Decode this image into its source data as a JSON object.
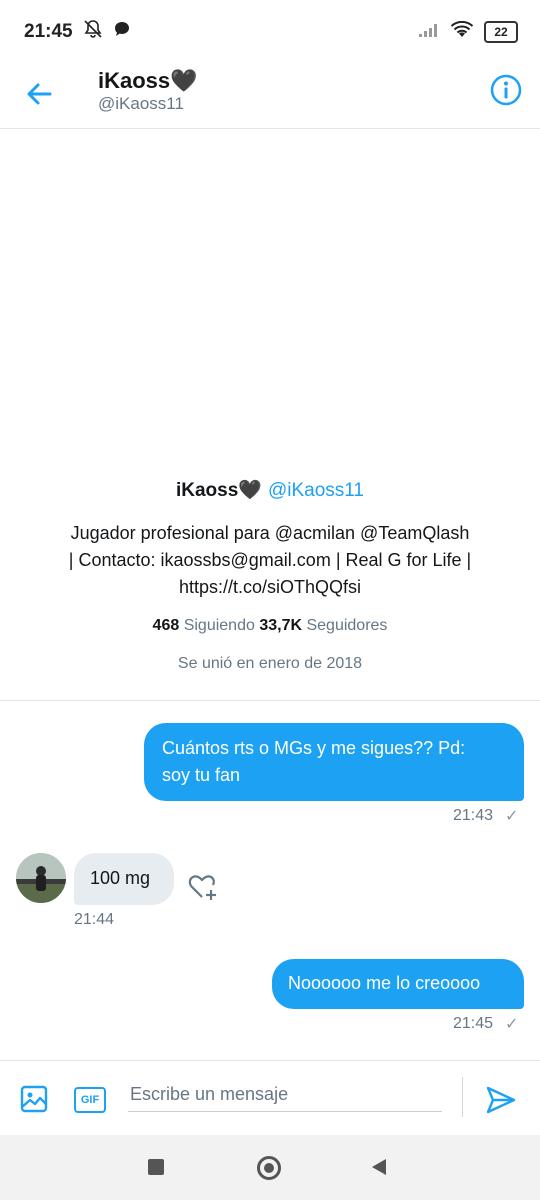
{
  "status_bar": {
    "time": "21:45",
    "battery": "22"
  },
  "header": {
    "name": "iKaoss🖤",
    "handle": "@iKaoss11"
  },
  "profile": {
    "name": "iKaoss🖤",
    "handle": "@iKaoss11",
    "bio_line1": "Jugador profesional para @acmilan @TeamQlash",
    "bio_line2": "| Contacto: ikaossbs@gmail.com | Real G for Life |",
    "bio_line3": "https://t.co/siOThQQfsi",
    "following_count": "468",
    "following_label": "Siguiendo",
    "followers_count": "33,7K",
    "followers_label": "Seguidores",
    "joined": "Se unió en enero de 2018"
  },
  "messages": [
    {
      "direction": "out",
      "line1": "Cuántos rts o MGs y me sigues?? Pd:",
      "line2": "soy tu fan",
      "time": "21:43"
    },
    {
      "direction": "in",
      "text": "100 mg",
      "time": "21:44"
    },
    {
      "direction": "out",
      "text": "Noooooo me lo creoooo",
      "time": "21:45"
    }
  ],
  "composer": {
    "gif_label": "GIF",
    "placeholder": "Escribe un mensaje"
  },
  "colors": {
    "accent": "#1da1f2",
    "incoming_bubble": "#e6ecf0",
    "secondary_text": "#657786"
  }
}
